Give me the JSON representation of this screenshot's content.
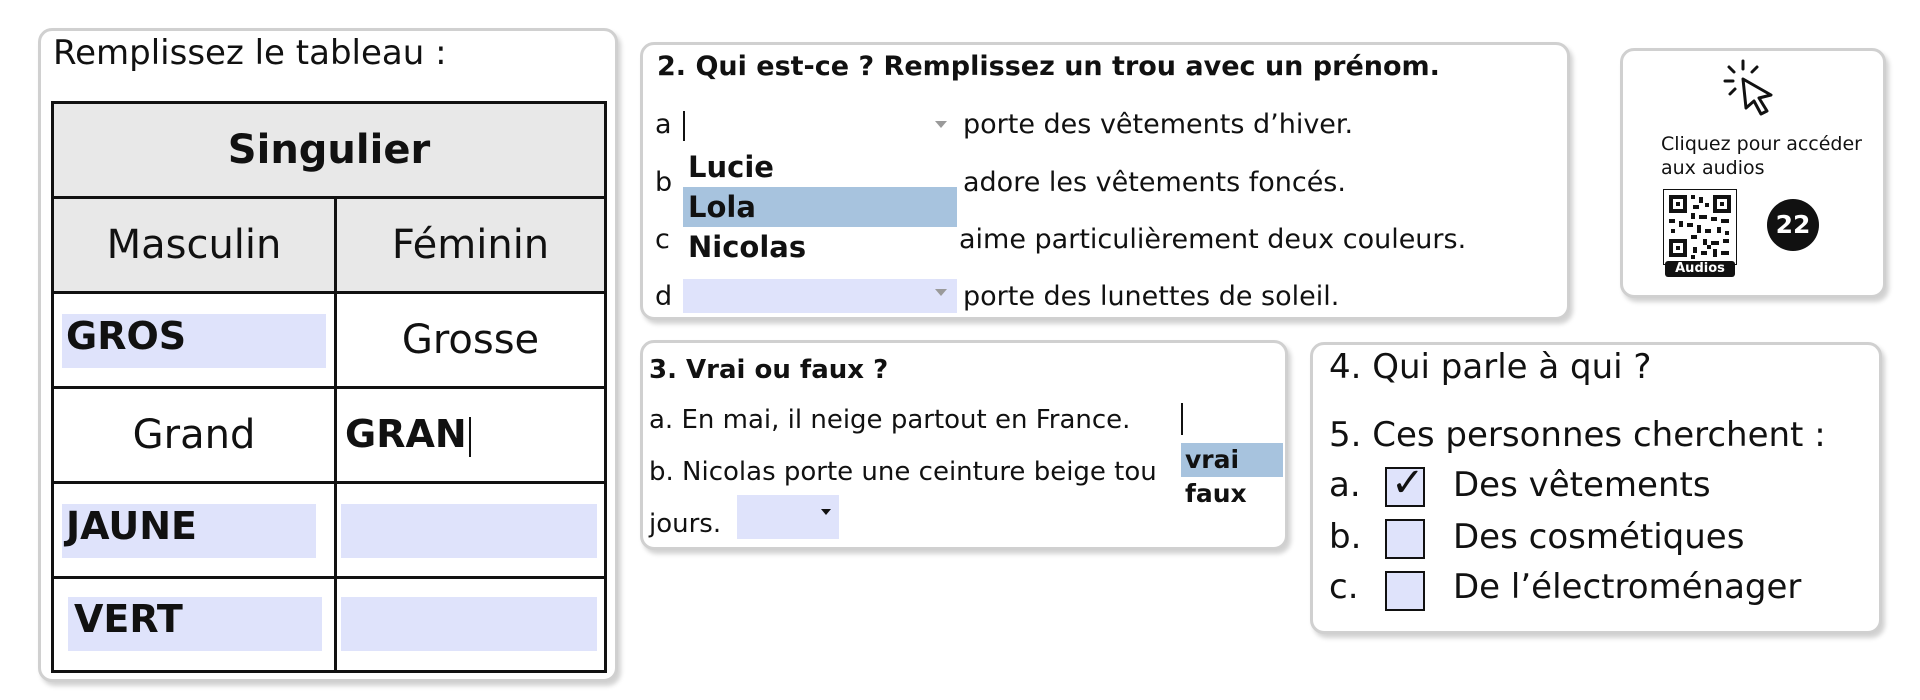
{
  "table_panel": {
    "title": "Remplissez le tableau :",
    "header": "Singulier",
    "columns": [
      "Masculin",
      "Féminin"
    ],
    "rows": [
      {
        "masculin": "GROS",
        "feminin": "Grosse"
      },
      {
        "masculin": "Grand",
        "feminin": "GRAN"
      },
      {
        "masculin": "JAUNE",
        "feminin": ""
      },
      {
        "masculin": "VERT",
        "feminin": ""
      }
    ]
  },
  "q2": {
    "title": "2. Qui est-ce ? Remplissez un trou avec un prénom.",
    "items": [
      {
        "letter": "a",
        "text": "porte des vêtements d’hiver."
      },
      {
        "letter": "b",
        "text": "adore les vêtements foncés."
      },
      {
        "letter": "c",
        "text": "aime particulièrement deux couleurs."
      },
      {
        "letter": "d",
        "text": "porte des lunettes de soleil."
      }
    ],
    "dropdown_options": [
      "Lucie",
      "Lola",
      "Nicolas"
    ],
    "highlighted_option": "Lola"
  },
  "q3": {
    "title": "3. Vrai ou faux ?",
    "a": "a. En mai, il neige partout en France.",
    "b_part1": "b. Nicolas porte une ceinture beige tou",
    "b_part2": "jours.",
    "options": [
      "vrai",
      "faux"
    ],
    "highlighted_option": "vrai"
  },
  "q4": {
    "title": "4. Qui parle à qui ?",
    "q5_title": "5. Ces personnes cherchent :",
    "choices": [
      {
        "letter": "a.",
        "label": "Des vêtements",
        "checked": true
      },
      {
        "letter": "b.",
        "label": "Des cosmétiques",
        "checked": false
      },
      {
        "letter": "c.",
        "label": "De l’électroménager",
        "checked": false
      }
    ]
  },
  "audio_panel": {
    "line1": "Cliquez pour accéder",
    "line2": "aux audios",
    "qr_caption": "Audios",
    "badge": "22"
  },
  "colors": {
    "field_bg": "#dfe3fb",
    "highlight": "#a7c3de",
    "border": "#d0d0d0"
  }
}
